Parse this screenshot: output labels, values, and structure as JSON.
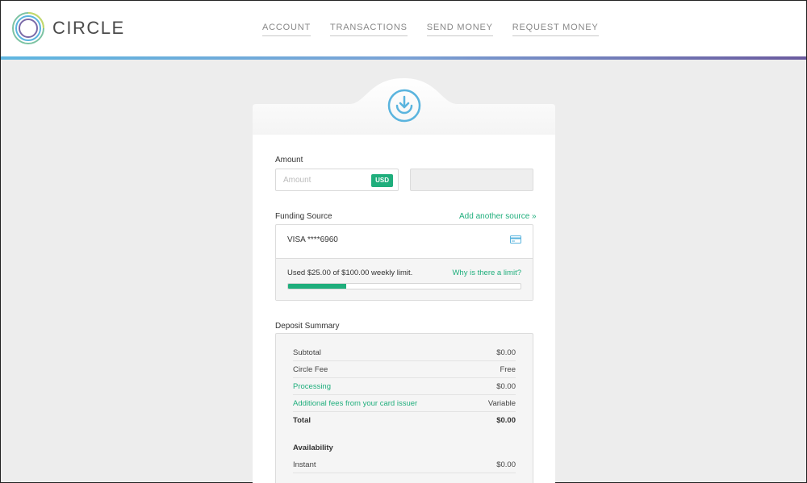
{
  "brand": {
    "name": "CIRCLE"
  },
  "nav": {
    "items": [
      "ACCOUNT",
      "TRANSACTIONS",
      "SEND MONEY",
      "REQUEST MONEY"
    ]
  },
  "deposit": {
    "icon": "download-icon",
    "amount": {
      "label": "Amount",
      "placeholder": "Amount",
      "currency": "USD"
    },
    "funding": {
      "label": "Funding Source",
      "add_link": "Add another source »",
      "card_text": "VISA ****6960",
      "card_icon": "credit-card-icon",
      "limit_text": "Used $25.00 of $100.00 weekly limit.",
      "limit_link": "Why is there a limit?",
      "limit_used_fraction": 0.25
    },
    "summary": {
      "label": "Deposit Summary",
      "rows": [
        {
          "key": "Subtotal",
          "value": "$0.00"
        },
        {
          "key": "Circle Fee",
          "value": "Free"
        },
        {
          "key": "Processing",
          "value": "$0.00"
        },
        {
          "key": "Additional fees from your card issuer",
          "value": "Variable"
        },
        {
          "key": "Total",
          "value": "$0.00"
        }
      ],
      "availability_title": "Availability",
      "availability_rows": [
        {
          "key": "Instant",
          "value": "$0.00"
        }
      ]
    }
  },
  "colors": {
    "accent": "#1fae7c",
    "icon_blue": "#5ab4de",
    "background": "#ededed"
  }
}
